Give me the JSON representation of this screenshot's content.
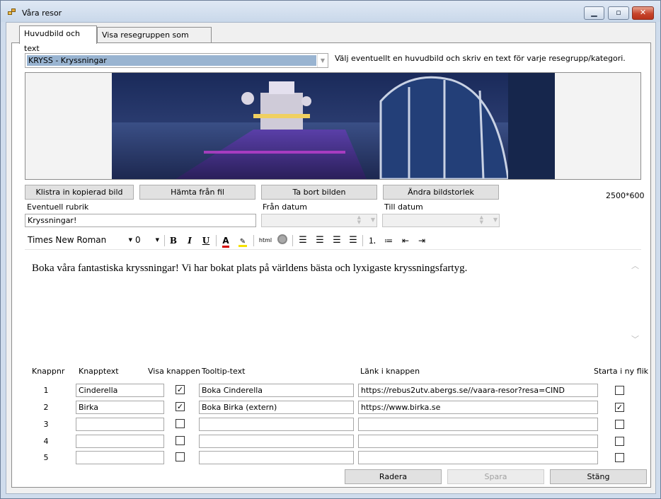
{
  "window": {
    "title": "Våra resor",
    "controls": {
      "minimize": "▁",
      "maximize": "▫",
      "close": "✕"
    }
  },
  "tabs": [
    {
      "label": "Huvudbild och text"
    },
    {
      "label": "Visa resegruppen som paket"
    }
  ],
  "category_select": {
    "value": "KRYSS - Kryssningar"
  },
  "hint_text": "Välj eventuellt en huvudbild och skriv en text för varje resegrupp/kategori.",
  "image_buttons": {
    "paste": "Klistra in kopierad bild",
    "from_file": "Hämta från fil",
    "remove": "Ta bort bilden",
    "resize": "Ändra bildstorlek"
  },
  "image_size": "2500*600",
  "headline": {
    "label": "Eventuell rubrik",
    "value": "Kryssningar!"
  },
  "from_date": {
    "label": "Från datum"
  },
  "to_date": {
    "label": "Till datum"
  },
  "editor_toolbar": {
    "font": "Times New Roman",
    "size": "0",
    "html_label": "html",
    "bold": "B",
    "italic": "I",
    "underline": "U"
  },
  "editor_text": "Boka våra fantastiska kryssningar! Vi har bokat plats på världens bästa och lyxigaste kryssningsfartyg.",
  "buttons_table": {
    "headers": {
      "nr": "Knappnr",
      "text": "Knapptext",
      "show": "Visa knappen",
      "tooltip": "Tooltip-text",
      "link": "Länk i knappen",
      "newtab": "Starta i ny flik"
    },
    "rows": [
      {
        "nr": "1",
        "text": "Cinderella",
        "show": true,
        "tooltip": "Boka Cinderella",
        "link": "https://rebus2utv.abergs.se//vaara-resor?resa=CIND",
        "newtab": false
      },
      {
        "nr": "2",
        "text": "Birka",
        "show": true,
        "tooltip": "Boka Birka (extern)",
        "link": "https://www.birka.se",
        "newtab": true
      },
      {
        "nr": "3",
        "text": "",
        "show": false,
        "tooltip": "",
        "link": "",
        "newtab": false
      },
      {
        "nr": "4",
        "text": "",
        "show": false,
        "tooltip": "",
        "link": "",
        "newtab": false
      },
      {
        "nr": "5",
        "text": "",
        "show": false,
        "tooltip": "",
        "link": "",
        "newtab": false
      }
    ]
  },
  "footer": {
    "delete": "Radera",
    "save": "Spara",
    "close": "Stäng"
  }
}
